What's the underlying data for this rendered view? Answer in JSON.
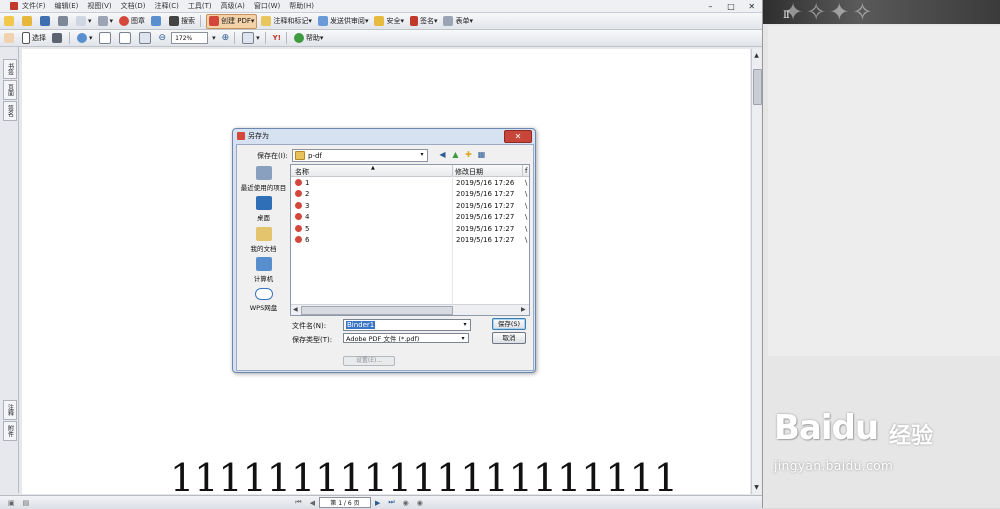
{
  "menubar": {
    "items": [
      "文件(F)",
      "编辑(E)",
      "视图(V)",
      "文档(D)",
      "注释(C)",
      "工具(T)",
      "高级(A)",
      "窗口(W)",
      "帮助(H)"
    ],
    "window_controls": [
      "–",
      "□",
      "✕"
    ]
  },
  "toolbar1": {
    "stamp_label": "图章",
    "search_label": "搜索",
    "create_pdf_label": "创建 PDF",
    "comment_markup_label": "注释和标记",
    "send_review_label": "发送供审阅",
    "secure_label": "安全",
    "sign_label": "签名",
    "forms_label": "表单"
  },
  "toolbar2": {
    "select_label": "选择",
    "zoom_value": "172%",
    "help_label": "帮助"
  },
  "side_tabs": [
    "书签",
    "页面",
    "签名",
    "注释",
    "附件"
  ],
  "document": {
    "digits": [
      "1",
      "1",
      "1",
      "1",
      "1",
      "1",
      "1",
      "1",
      "1",
      "1",
      "1",
      "1",
      "1",
      "1",
      "1",
      "1",
      "1",
      "1",
      "1",
      "1",
      "1"
    ]
  },
  "statusbar": {
    "page_indicator": "第 1 / 6 页"
  },
  "dialog": {
    "title": "另存为",
    "close_label": "✕",
    "save_in_label": "保存在(I):",
    "save_in_value": "p-df",
    "places": [
      {
        "label": "最近使用的项目",
        "icon": "recent-items-icon",
        "color": "#8aa0bf"
      },
      {
        "label": "桌面",
        "icon": "desktop-icon",
        "color": "#2f6fb8"
      },
      {
        "label": "我的文档",
        "icon": "my-documents-icon",
        "color": "#e4c46c"
      },
      {
        "label": "计算机",
        "icon": "computer-icon",
        "color": "#5a8fcf"
      },
      {
        "label": "WPS网盘",
        "icon": "wps-cloud-icon",
        "color": "#ffffff"
      }
    ],
    "columns": {
      "name": "名称",
      "modified": "修改日期",
      "type": "f"
    },
    "files": [
      {
        "name": "1",
        "modified": "2019/5/16 17:26",
        "type": "\\"
      },
      {
        "name": "2",
        "modified": "2019/5/16 17:27",
        "type": "\\"
      },
      {
        "name": "3",
        "modified": "2019/5/16 17:27",
        "type": "\\"
      },
      {
        "name": "4",
        "modified": "2019/5/16 17:27",
        "type": "\\"
      },
      {
        "name": "5",
        "modified": "2019/5/16 17:27",
        "type": "\\"
      },
      {
        "name": "6",
        "modified": "2019/5/16 17:27",
        "type": "\\"
      }
    ],
    "file_name_label": "文件名(N):",
    "file_name_value": "Binder1",
    "file_type_label": "保存类型(T):",
    "file_type_value": "Adobe PDF 文件 (*.pdf)",
    "save_button": "保存(S)",
    "cancel_button": "取消",
    "settings_button": "设置(E)..."
  },
  "watermark": {
    "logo": "Baidu",
    "cn": "经验",
    "url": "jingyan.baidu.com"
  },
  "colors": {
    "dialog_frame": "#d6e2f1",
    "close_button": "#c8453a",
    "selection": "#3a74c4"
  }
}
